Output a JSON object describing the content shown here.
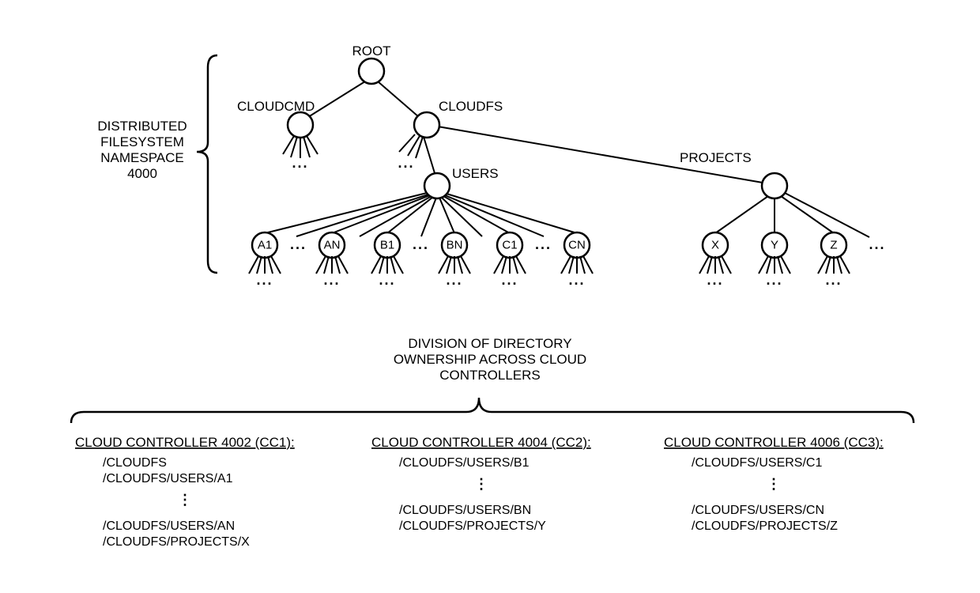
{
  "namespace_label": [
    "DISTRIBUTED",
    "FILESYSTEM",
    "NAMESPACE",
    "4000"
  ],
  "tree": {
    "root": "ROOT",
    "cloudcmd": "CLOUDCMD",
    "cloudfs": "CLOUDFS",
    "users": "USERS",
    "projects": "PROJECTS",
    "leaves_users": [
      "A1",
      "AN",
      "B1",
      "BN",
      "C1",
      "CN"
    ],
    "leaves_projects": [
      "X",
      "Y",
      "Z"
    ]
  },
  "division_label": [
    "DIVISION OF DIRECTORY",
    "OWNERSHIP ACROSS CLOUD",
    "CONTROLLERS"
  ],
  "controllers": [
    {
      "title": "CLOUD CONTROLLER 4002 (CC1):",
      "paths_top": [
        "/CLOUDFS",
        "/CLOUDFS/USERS/A1"
      ],
      "paths_bottom": [
        "/CLOUDFS/USERS/AN",
        "/CLOUDFS/PROJECTS/X"
      ]
    },
    {
      "title": "CLOUD CONTROLLER 4004 (CC2):",
      "paths_top": [
        "/CLOUDFS/USERS/B1"
      ],
      "paths_bottom": [
        "/CLOUDFS/USERS/BN",
        "/CLOUDFS/PROJECTS/Y"
      ]
    },
    {
      "title": "CLOUD CONTROLLER 4006 (CC3):",
      "paths_top": [
        "/CLOUDFS/USERS/C1"
      ],
      "paths_bottom": [
        "/CLOUDFS/USERS/CN",
        "/CLOUDFS/PROJECTS/Z"
      ]
    }
  ],
  "ellipsis": "...",
  "vdots": "⋮"
}
